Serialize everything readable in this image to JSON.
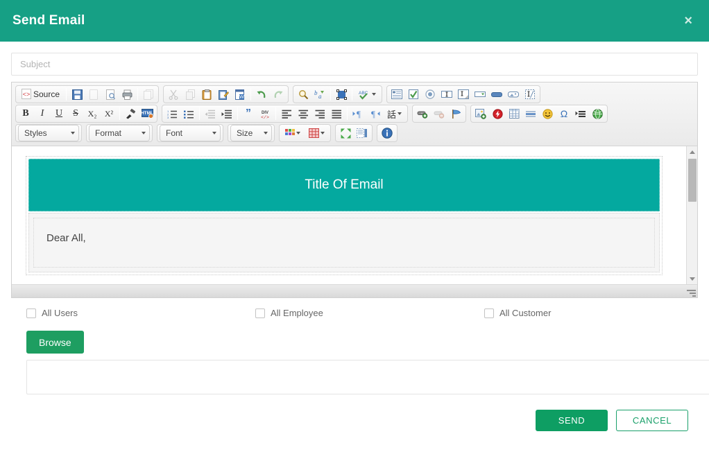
{
  "header": {
    "title": "Send Email",
    "close_label": "×"
  },
  "subject": {
    "placeholder": "Subject",
    "value": ""
  },
  "editor": {
    "toolbar_rows": [
      {
        "groups": [
          {
            "buttons": [
              {
                "name": "source-button",
                "label": "Source",
                "type": "text"
              },
              {
                "name": "save-icon",
                "label": "",
                "type": "sep"
              },
              {
                "name": "save-icon",
                "label": "",
                "type": "icon"
              },
              {
                "name": "new-page-icon",
                "label": "",
                "type": "icon"
              },
              {
                "name": "preview-icon",
                "label": "",
                "type": "icon"
              },
              {
                "name": "print-icon",
                "label": "",
                "type": "icon"
              },
              {
                "name": "templates-icon",
                "label": "",
                "type": "icon"
              }
            ]
          },
          {
            "buttons": [
              {
                "name": "cut-icon",
                "label": ""
              },
              {
                "name": "copy-icon",
                "label": ""
              },
              {
                "name": "paste-icon",
                "label": ""
              },
              {
                "name": "paste-as-plain-text-icon",
                "label": ""
              },
              {
                "name": "paste-from-word-icon",
                "label": ""
              },
              {
                "name": "undo-icon",
                "label": ""
              },
              {
                "name": "redo-icon",
                "label": ""
              }
            ]
          },
          {
            "buttons": [
              {
                "name": "find-icon",
                "label": ""
              },
              {
                "name": "replace-icon",
                "label": ""
              },
              {
                "name": "select-all-icon",
                "label": ""
              },
              {
                "name": "spell-check-icon",
                "label": ""
              }
            ]
          },
          {
            "buttons": [
              {
                "name": "form-icon",
                "label": ""
              },
              {
                "name": "checkbox-icon",
                "label": ""
              },
              {
                "name": "radio-button-icon",
                "label": ""
              },
              {
                "name": "text-field-icon",
                "label": ""
              },
              {
                "name": "textarea-icon",
                "label": ""
              },
              {
                "name": "select-field-icon",
                "label": ""
              },
              {
                "name": "button-icon",
                "label": ""
              },
              {
                "name": "image-button-icon",
                "label": ""
              },
              {
                "name": "hidden-field-icon",
                "label": ""
              }
            ]
          }
        ]
      },
      {
        "groups": [
          {
            "buttons": [
              {
                "name": "bold-icon",
                "label": "B"
              },
              {
                "name": "italic-icon",
                "label": "I"
              },
              {
                "name": "underline-icon",
                "label": "U"
              },
              {
                "name": "strikethrough-icon",
                "label": "S"
              },
              {
                "name": "subscript-icon",
                "label": "X₂"
              },
              {
                "name": "superscript-icon",
                "label": "X²"
              },
              {
                "name": "remove-format-icon",
                "label": ""
              },
              {
                "name": "html-icon",
                "label": "HTML"
              }
            ]
          },
          {
            "buttons": [
              {
                "name": "numbered-list-icon",
                "label": ""
              },
              {
                "name": "bulleted-list-icon",
                "label": ""
              },
              {
                "name": "decrease-indent-icon",
                "label": ""
              },
              {
                "name": "increase-indent-icon",
                "label": ""
              },
              {
                "name": "blockquote-icon",
                "label": "”"
              },
              {
                "name": "create-div-icon",
                "label": "DIV"
              },
              {
                "name": "align-left-icon",
                "label": ""
              },
              {
                "name": "align-center-icon",
                "label": ""
              },
              {
                "name": "align-right-icon",
                "label": ""
              },
              {
                "name": "justify-icon",
                "label": ""
              },
              {
                "name": "text-direction-ltr-icon",
                "label": ""
              },
              {
                "name": "text-direction-rtl-icon",
                "label": ""
              },
              {
                "name": "language-icon",
                "label": "話"
              }
            ]
          },
          {
            "buttons": [
              {
                "name": "link-icon",
                "label": ""
              },
              {
                "name": "unlink-icon",
                "label": ""
              },
              {
                "name": "anchor-icon",
                "label": ""
              }
            ]
          },
          {
            "buttons": [
              {
                "name": "image-icon",
                "label": ""
              },
              {
                "name": "flash-icon",
                "label": ""
              },
              {
                "name": "table-icon",
                "label": ""
              },
              {
                "name": "horizontal-rule-icon",
                "label": ""
              },
              {
                "name": "smiley-icon",
                "label": "☺"
              },
              {
                "name": "special-character-icon",
                "label": "Ω"
              },
              {
                "name": "page-break-icon",
                "label": ""
              },
              {
                "name": "iframe-icon",
                "label": ""
              }
            ]
          }
        ]
      }
    ],
    "selects": [
      {
        "name": "styles-select",
        "label": "Styles"
      },
      {
        "name": "format-select",
        "label": "Format"
      },
      {
        "name": "font-select",
        "label": "Font"
      },
      {
        "name": "size-select",
        "label": "Size"
      }
    ],
    "extra_buttons": [
      {
        "name": "text-color-icon",
        "label": ""
      },
      {
        "name": "background-color-icon",
        "label": ""
      },
      {
        "name": "maximize-icon",
        "label": ""
      },
      {
        "name": "show-blocks-icon",
        "label": ""
      },
      {
        "name": "about-icon",
        "label": "i"
      }
    ],
    "content": {
      "email_title": "Title Of Email",
      "email_greeting": "Dear All,"
    }
  },
  "recipients": {
    "checkboxes": [
      {
        "label": "All Users",
        "checked": false
      },
      {
        "label": "All Employee",
        "checked": false
      },
      {
        "label": "All Customer",
        "checked": false
      }
    ]
  },
  "attachments": {
    "browse_label": "Browse",
    "file_list": ""
  },
  "footer": {
    "send_label": "SEND",
    "cancel_label": "CANCEL"
  },
  "colors": {
    "header_green": "#16a085",
    "email_banner_teal": "#04a99f",
    "browse_green": "#1e9e61",
    "send_green": "#0e9e63",
    "cancel_green": "#19a06a"
  }
}
